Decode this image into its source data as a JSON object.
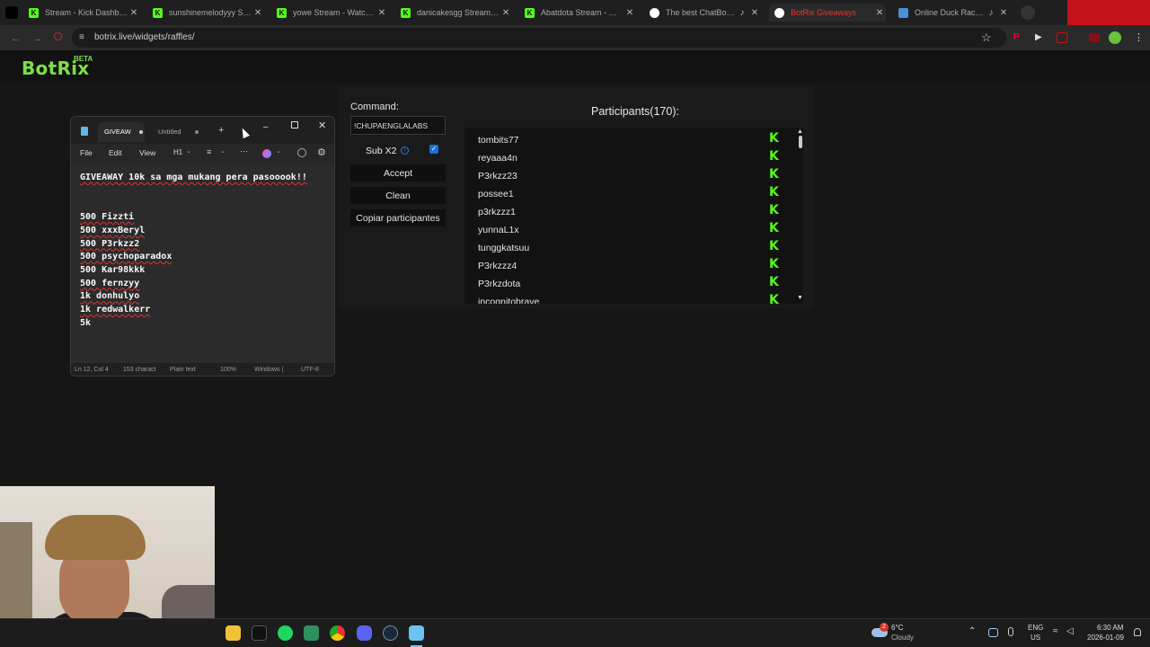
{
  "browser": {
    "tabs": [
      {
        "title": "Stream - Kick Dashboard",
        "favicon": "kick-icon",
        "audio": false
      },
      {
        "title": "sunshinemelodyyy Stream - Watch Live on Kick",
        "favicon": "kick-icon",
        "audio": false
      },
      {
        "title": "yowe Stream - Watch Live on Kick",
        "favicon": "kick-icon",
        "audio": false
      },
      {
        "title": "danicakesgg Stream - Watch Live on Kick",
        "favicon": "kick-icon",
        "audio": false
      },
      {
        "title": "Abatdota Stream - Watch Live on Kick",
        "favicon": "kick-icon",
        "audio": false
      },
      {
        "title": "The best ChatBot and Stream tools",
        "favicon": "botrix-icon",
        "audio": true
      },
      {
        "title": "BotRix Giveaways",
        "favicon": "botrix-icon",
        "audio": false,
        "active": true
      },
      {
        "title": "Online Duck Race Name Picker",
        "favicon": "web-icon",
        "audio": true
      }
    ],
    "url": "botrix.live/widgets/raffles/"
  },
  "site": {
    "logo": "BotRix",
    "beta": "BETA"
  },
  "raffle": {
    "command_label": "Command:",
    "command_value": "!CHUPAENGLALABS",
    "subx2_label": "Sub X2",
    "subx2_checked": true,
    "accept_label": "Accept",
    "clean_label": "Clean",
    "copy_label": "Copiar participantes",
    "participants_title": "Participants(170):",
    "participants": [
      "tombits77",
      "reyaaa4n",
      "P3rkzz23",
      "possee1",
      "p3rkzzz1",
      "yunnaL1x",
      "tunggkatsuu",
      "P3rkzzz4",
      "P3rkzdota",
      "incognitobrave"
    ]
  },
  "notepad": {
    "tabs": [
      {
        "title": "GIVEAW",
        "active": true,
        "modified": true
      },
      {
        "title": "Untitled",
        "active": false,
        "modified": true
      }
    ],
    "menu": [
      "File",
      "Edit",
      "View"
    ],
    "heading_label": "H1",
    "lines": [
      "GIVEAWAY 10k sa mga mukang pera pasooook!!",
      "",
      "",
      "500 Fizzti",
      "500 xxxBeryl",
      "500 P3rkzz2",
      "500 psychoparadox",
      "500 Kar98kkk",
      "500 fernzyy",
      "1k donhulyo",
      "1k redwalkerr",
      "5k"
    ],
    "status": {
      "position": "Ln 12, Col 4",
      "chars": "153 charact",
      "format": "Plain text",
      "zoom": "100%",
      "line_ending": "Windows (",
      "encoding": "UTF-8"
    }
  },
  "taskbar": {
    "weather_temp": "6°C",
    "weather_text": "Cloudy",
    "weather_badge": "2",
    "lang_top": "ENG",
    "lang_bottom": "US",
    "time": "6:30 AM",
    "date": "2026-01-09"
  },
  "colors": {
    "accent_green": "#7be04a",
    "kick_green": "#53fc18",
    "checkbox_blue": "#1e6fd8"
  }
}
